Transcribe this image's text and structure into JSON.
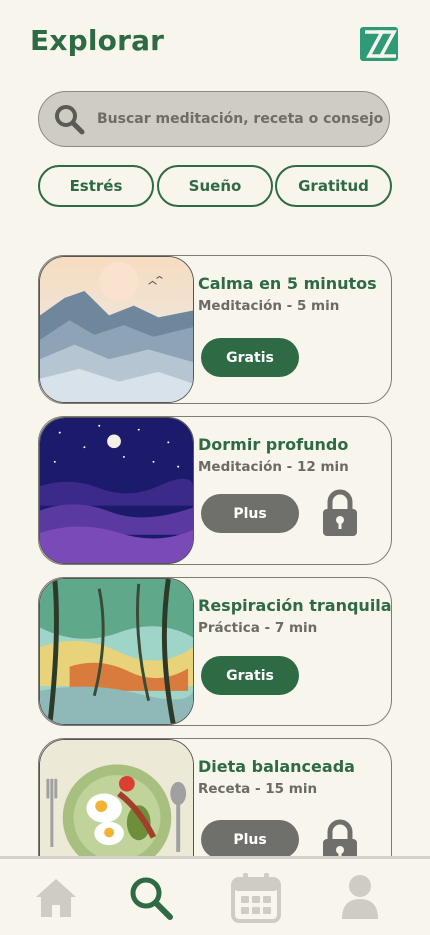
{
  "header": {
    "title": "Explorar",
    "logo_icon": "zz-logo-icon"
  },
  "search": {
    "placeholder": "Buscar meditación, receta o consejo",
    "icon": "search-icon"
  },
  "filters": [
    {
      "label": "Estrés"
    },
    {
      "label": "Sueño"
    },
    {
      "label": "Gratitud"
    }
  ],
  "cards": [
    {
      "title": "Calma en 5 minutos",
      "subtitle": "Meditación - 5 min",
      "badge": "Gratis",
      "locked": false,
      "image": "misty-mountains"
    },
    {
      "title": "Dormir profundo",
      "subtitle": "Meditación - 12 min",
      "badge": "Plus",
      "locked": true,
      "image": "night-sky-clouds"
    },
    {
      "title": "Respiración tranquila",
      "subtitle": "Práctica - 7 min",
      "badge": "Gratis",
      "locked": false,
      "image": "watercolor-forest"
    },
    {
      "title": "Dieta balanceada",
      "subtitle": "Receta - 15 min",
      "badge": "Plus",
      "locked": true,
      "image": "breakfast-plate"
    }
  ],
  "nav": [
    {
      "name": "home",
      "icon": "home-icon",
      "active": false
    },
    {
      "name": "explore",
      "icon": "search-icon",
      "active": true
    },
    {
      "name": "calendar",
      "icon": "calendar-icon",
      "active": false
    },
    {
      "name": "profile",
      "icon": "user-icon",
      "active": false
    }
  ],
  "colors": {
    "brand": "#2e6b45",
    "background": "#f8f5ec",
    "plus": "#6f6f6c",
    "inactive": "#cfccc3"
  }
}
